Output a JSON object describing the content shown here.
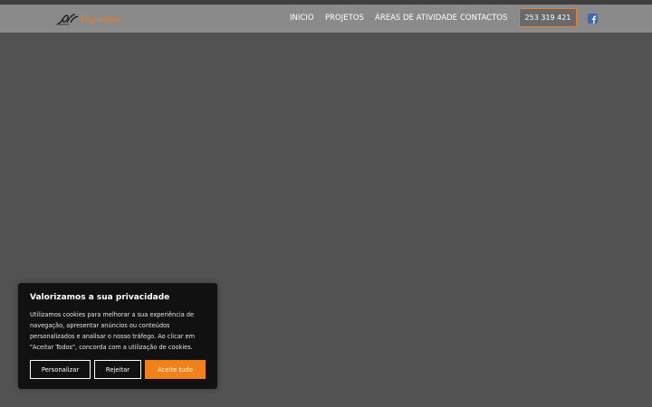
{
  "header": {
    "logo_text": "Engenharia",
    "nav": [
      {
        "label": "INICIO"
      },
      {
        "label": "PROJETOS"
      },
      {
        "label": "ÁREAS DE ATIVIDADE"
      },
      {
        "label": "CONTACTOS"
      }
    ],
    "phone": "253 319 421",
    "social_icon": "facebook-icon"
  },
  "cookie_banner": {
    "title": "Valorizamos a sua privacidade",
    "text": "Utilizamos cookies para melhorar a sua experiência de navegação, apresentar anúncios ou conteúdos personalizados e analisar o nosso tráfego. Ao clicar em \"Aceitar Todos\", concorda com a utilização de cookies.",
    "buttons": {
      "customize": "Personalizar",
      "reject": "Rejeitar",
      "accept": "Aceite tudo"
    }
  },
  "colors": {
    "accent": "#f0821c",
    "page_bg": "#525252",
    "nav_bg": "#8a8a8a",
    "facebook": "#4267b2"
  }
}
